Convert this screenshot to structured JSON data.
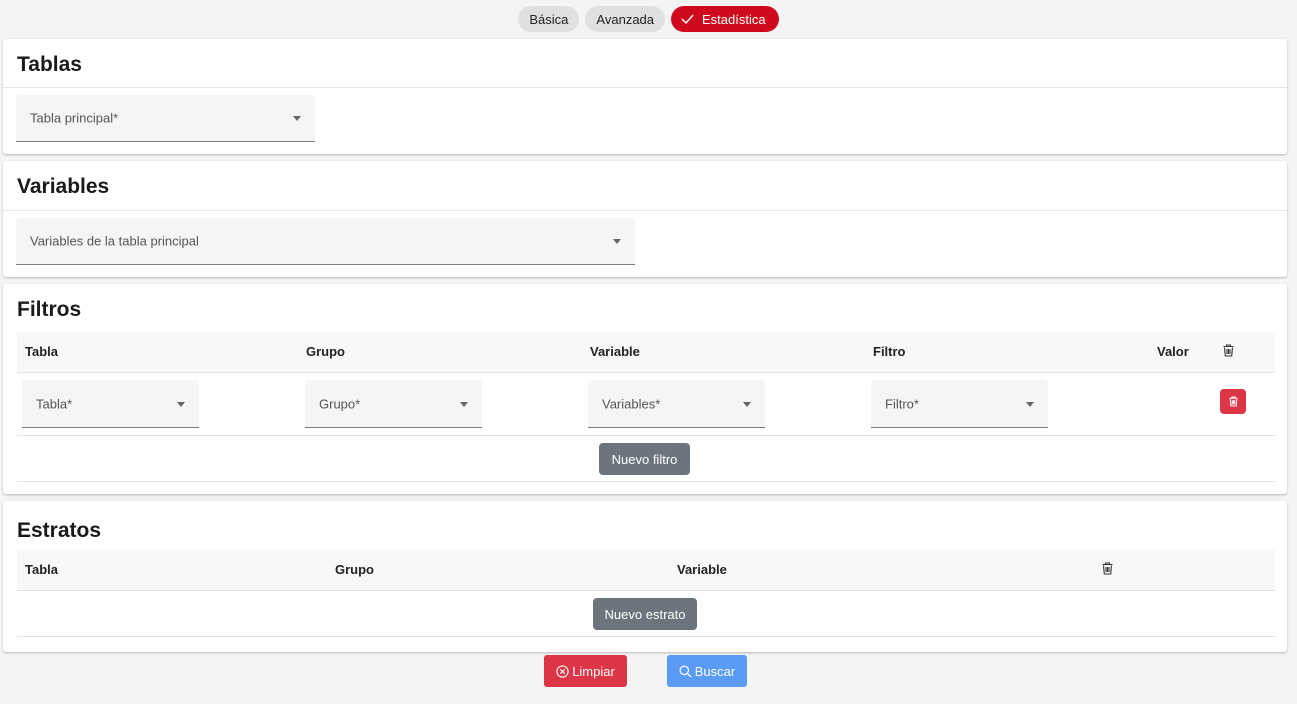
{
  "mode_tabs": [
    {
      "label": "Básica"
    },
    {
      "label": "Avanzada"
    },
    {
      "label": "Estadística"
    }
  ],
  "tablas": {
    "title": "Tablas",
    "select_label": "Tabla principal*"
  },
  "variables": {
    "title": "Variables",
    "select_label": "Variables de la tabla principal"
  },
  "filtros": {
    "title": "Filtros",
    "columns": [
      "Tabla",
      "Grupo",
      "Variable",
      "Filtro",
      "Valor"
    ],
    "row": {
      "tabla": "Tabla*",
      "grupo": "Grupo*",
      "variable": "Variables*",
      "filtro": "Filtro*"
    },
    "add_label": "Nuevo filtro"
  },
  "estratos": {
    "title": "Estratos",
    "columns": [
      "Tabla",
      "Grupo",
      "Variable"
    ],
    "add_label": "Nuevo estrato"
  },
  "actions": {
    "clear_label": "Limpiar",
    "search_label": "Buscar"
  },
  "colors": {
    "accent": "#cf0a1e",
    "danger": "#dc3545",
    "primary": "#5a9bf7",
    "secondary": "#6c757d"
  },
  "icons": [
    "check-icon",
    "trash-icon",
    "dropdown-arrow-icon",
    "close-circle-icon",
    "search-icon"
  ]
}
